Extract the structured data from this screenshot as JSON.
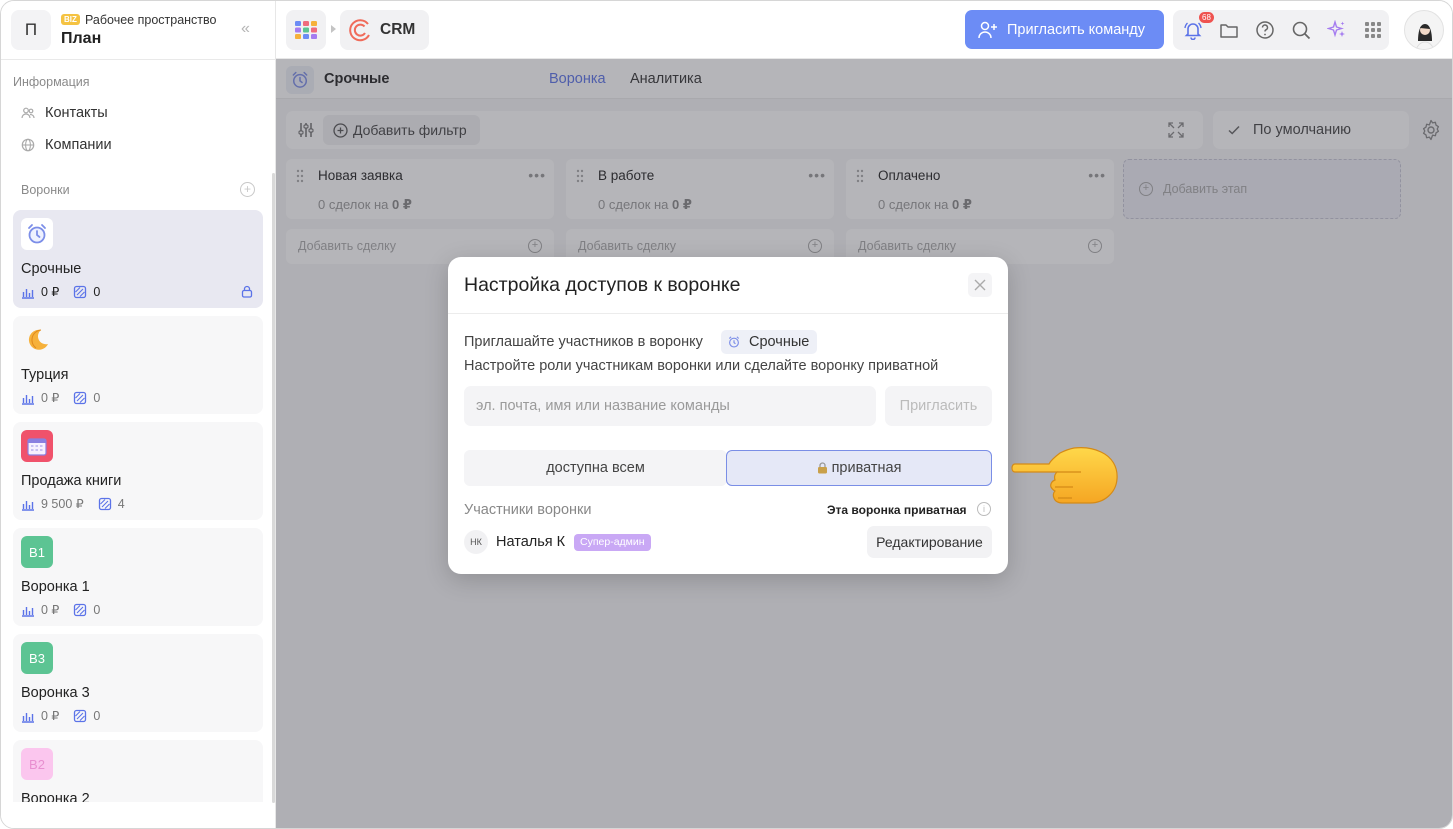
{
  "workspace": {
    "avatar_letter": "П",
    "badge": "BIZ",
    "label": "Рабочее пространство",
    "name": "План"
  },
  "sidebar": {
    "info_title": "Информация",
    "info_items": [
      {
        "label": "Контакты",
        "icon": "users-icon"
      },
      {
        "label": "Компании",
        "icon": "globe-icon"
      }
    ],
    "pipelines_title": "Воронки",
    "pipelines": [
      {
        "title": "Срочные",
        "icon": "alarm-clock-icon",
        "amount": "0 ₽",
        "deals": "0",
        "private": true,
        "active": true
      },
      {
        "title": "Турция",
        "icon": "crescent-moon-icon",
        "amount": "0 ₽",
        "deals": "0"
      },
      {
        "title": "Продажа книги",
        "icon": "calendar-icon",
        "amount": "9 500 ₽",
        "deals": "4"
      },
      {
        "title": "Воронка 1",
        "icon_text": "В1",
        "color": "#5cc493",
        "amount": "0 ₽",
        "deals": "0"
      },
      {
        "title": "Воронка 3",
        "icon_text": "В3",
        "color": "#5cc493",
        "amount": "0 ₽",
        "deals": "0"
      },
      {
        "title": "Воронка 2",
        "icon_text": "В2",
        "color": "#f5a8e0",
        "amount": "",
        "deals": ""
      }
    ]
  },
  "topbar": {
    "app_name": "CRM",
    "invite_label": "Пригласить команду",
    "notifications_count": "68",
    "accent_color": "#6c8cf5"
  },
  "pipeline_header": {
    "title": "Срочные",
    "tabs": [
      {
        "label": "Воронка",
        "active": true
      },
      {
        "label": "Аналитика",
        "active": false
      }
    ]
  },
  "toolbar": {
    "add_filter": "Добавить фильтр",
    "default_view": "По умолчанию"
  },
  "stages": [
    {
      "title": "Новая заявка",
      "count": "0",
      "sum": "0 ₽"
    },
    {
      "title": "В работе",
      "count": "0",
      "sum": "0 ₽"
    },
    {
      "title": "Оплачено",
      "count": "0",
      "sum": "0 ₽"
    }
  ],
  "stage_text": {
    "deals_word": "сделок на",
    "add_deal": "Добавить сделку",
    "add_stage": "Добавить этап"
  },
  "modal": {
    "title": "Настройка доступов к воронке",
    "invite_text": "Приглашайте участников в воронку",
    "pipeline_chip": "Срочные",
    "roles_text": "Настройте роли участникам воронки или сделайте воронку приватной",
    "input_placeholder": "эл. почта, имя или название команды",
    "invite_button": "Пригласить",
    "access_all": "доступна всем",
    "access_private": "приватная",
    "members_title": "Участники воронки",
    "private_note": "Эта воронка приватная",
    "member": {
      "initials": "НК",
      "name": "Наталья К",
      "role": "Супер-админ",
      "permission": "Редактирование"
    }
  }
}
